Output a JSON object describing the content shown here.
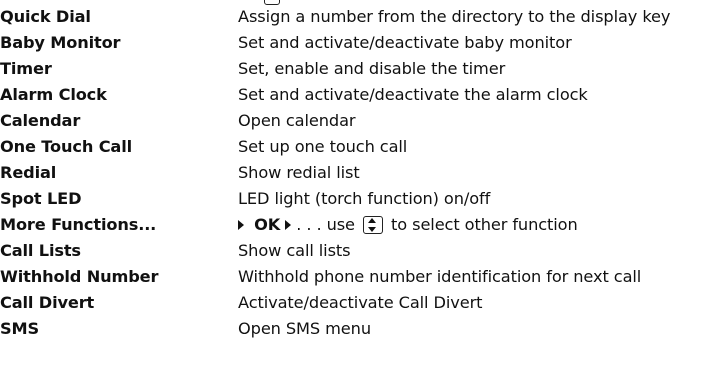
{
  "rows": [
    {
      "term": "Quick Dial",
      "description": "Assign a number from the directory to the display key"
    },
    {
      "term": "Baby Monitor",
      "description": "Set and activate/deactivate baby monitor"
    },
    {
      "term": "Timer",
      "description": "Set, enable and disable the timer"
    },
    {
      "term": "Alarm Clock",
      "description": "Set and activate/deactivate the alarm clock"
    },
    {
      "term": "Calendar",
      "description": "Open calendar"
    },
    {
      "term": "One Touch Call",
      "description": "Set up one touch call"
    },
    {
      "term": "Redial",
      "description": "Show redial list"
    },
    {
      "term": "Spot LED",
      "description": "LED light (torch function) on/off"
    },
    {
      "term": "More Functions...",
      "description_parts": {
        "ok": "OK",
        "mid": " . . . use ",
        "end": " to select other function"
      }
    },
    {
      "term": "Call Lists",
      "description": "Show call lists"
    },
    {
      "term": "Withhold Number",
      "description": "Withhold phone number identification for next call"
    },
    {
      "term": "Call Divert",
      "description": "Activate/deactivate Call Divert"
    },
    {
      "term": "SMS",
      "description": "Open SMS menu"
    }
  ],
  "icons": {
    "arrow": "triangle-right-icon",
    "nav_key": "navigation-key-up-down-icon"
  }
}
